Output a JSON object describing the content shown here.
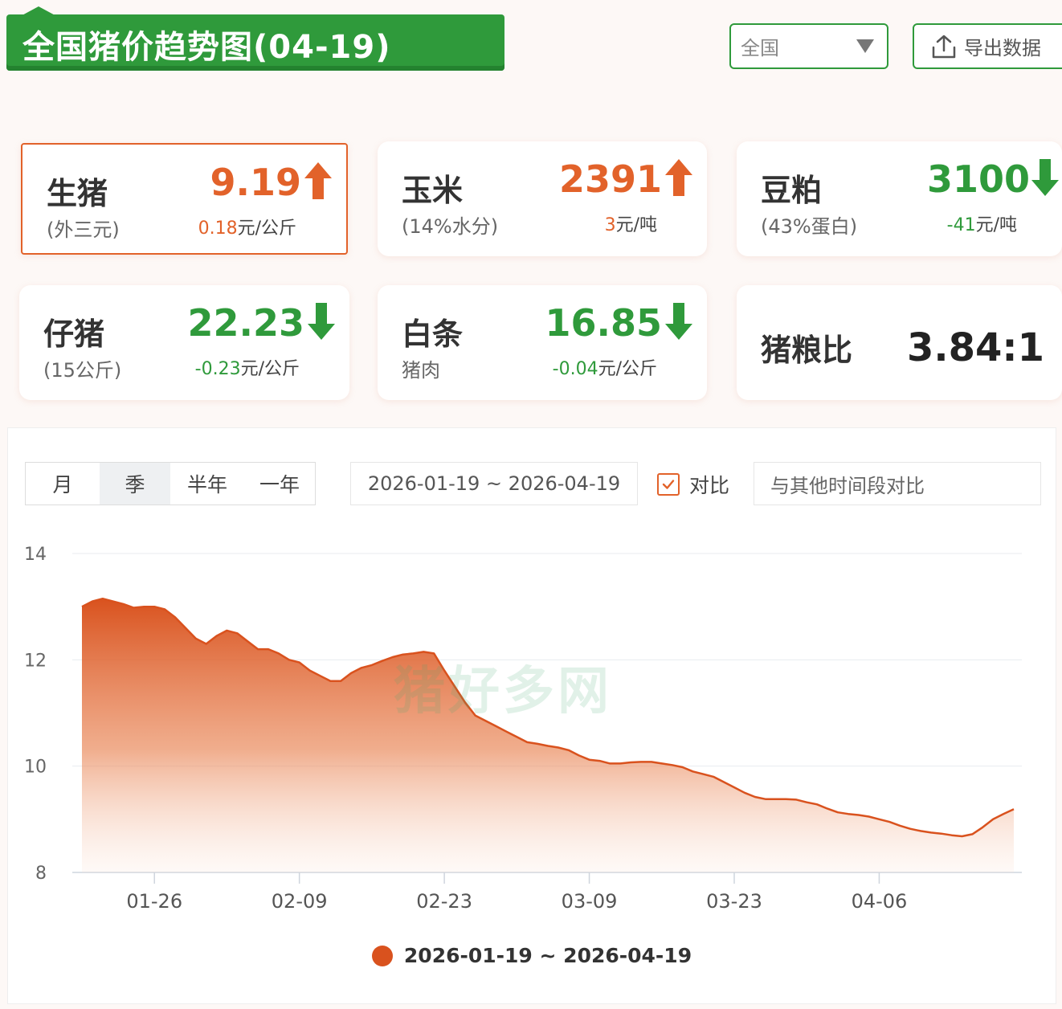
{
  "header": {
    "title": "全国猪价趋势图(04-19)",
    "region_value": "全国",
    "export_label": "导出数据"
  },
  "cards": [
    {
      "name": "生猪",
      "sub": "(外三元)",
      "value": "9.19",
      "trend": "up",
      "change_num": "0.18",
      "change_unit": "元/公斤"
    },
    {
      "name": "玉米",
      "sub": "(14%水分)",
      "value": "2391",
      "trend": "up",
      "change_num": "3",
      "change_unit": "元/吨"
    },
    {
      "name": "豆粕",
      "sub": "(43%蛋白)",
      "value": "3100",
      "trend": "down",
      "change_num": "-41",
      "change_unit": "元/吨"
    },
    {
      "name": "仔猪",
      "sub": "(15公斤)",
      "value": "22.23",
      "trend": "down",
      "change_num": "-0.23",
      "change_unit": "元/公斤"
    },
    {
      "name": "白条",
      "sub": "猪肉",
      "value": "16.85",
      "trend": "down",
      "change_num": "-0.04",
      "change_unit": "元/公斤"
    }
  ],
  "ratio": {
    "name": "猪粮比",
    "value": "3.84:1"
  },
  "controls": {
    "periods": [
      "月",
      "季",
      "半年",
      "一年"
    ],
    "selected_period": "季",
    "date_range": "2026-01-19 ~ 2026-04-19",
    "compare_label": "对比",
    "compare_checked": true,
    "compare_placeholder": "与其他时间段对比"
  },
  "watermark": "猪好多网",
  "colors": {
    "up": "#e2622a",
    "down": "#2f9a3b",
    "brand": "#2f9a3b",
    "series": "#d9521e"
  },
  "chart_data": {
    "type": "area",
    "ylim": [
      8,
      14
    ],
    "yticks": [
      8,
      10,
      12,
      14
    ],
    "grid": true,
    "xlim": [
      "2026-01-19",
      "2026-04-19"
    ],
    "xticks": [
      "01-26",
      "02-09",
      "02-23",
      "03-09",
      "03-23",
      "04-06"
    ],
    "xtick_dates": [
      "2026-01-26",
      "2026-02-09",
      "2026-02-23",
      "2026-03-09",
      "2026-03-23",
      "2026-04-06"
    ],
    "legend_position": "bottom-center",
    "series": [
      {
        "name": "2026-01-19 ~ 2026-04-19",
        "x": [
          "2026-01-19",
          "2026-01-20",
          "2026-01-21",
          "2026-01-22",
          "2026-01-23",
          "2026-01-24",
          "2026-01-25",
          "2026-01-26",
          "2026-01-27",
          "2026-01-28",
          "2026-01-29",
          "2026-01-30",
          "2026-01-31",
          "2026-02-01",
          "2026-02-02",
          "2026-02-03",
          "2026-02-04",
          "2026-02-05",
          "2026-02-06",
          "2026-02-07",
          "2026-02-08",
          "2026-02-09",
          "2026-02-10",
          "2026-02-11",
          "2026-02-12",
          "2026-02-13",
          "2026-02-14",
          "2026-02-15",
          "2026-02-16",
          "2026-02-17",
          "2026-02-18",
          "2026-02-19",
          "2026-02-20",
          "2026-02-21",
          "2026-02-22",
          "2026-02-23",
          "2026-02-24",
          "2026-02-25",
          "2026-02-26",
          "2026-02-27",
          "2026-02-28",
          "2026-03-01",
          "2026-03-02",
          "2026-03-03",
          "2026-03-04",
          "2026-03-05",
          "2026-03-06",
          "2026-03-07",
          "2026-03-08",
          "2026-03-09",
          "2026-03-10",
          "2026-03-11",
          "2026-03-12",
          "2026-03-13",
          "2026-03-14",
          "2026-03-15",
          "2026-03-16",
          "2026-03-17",
          "2026-03-18",
          "2026-03-19",
          "2026-03-20",
          "2026-03-21",
          "2026-03-22",
          "2026-03-23",
          "2026-03-24",
          "2026-03-25",
          "2026-03-26",
          "2026-03-27",
          "2026-03-28",
          "2026-03-29",
          "2026-03-30",
          "2026-03-31",
          "2026-04-01",
          "2026-04-02",
          "2026-04-03",
          "2026-04-04",
          "2026-04-05",
          "2026-04-06",
          "2026-04-07",
          "2026-04-08",
          "2026-04-09",
          "2026-04-10",
          "2026-04-11",
          "2026-04-12",
          "2026-04-13",
          "2026-04-14",
          "2026-04-15",
          "2026-04-16",
          "2026-04-17",
          "2026-04-18",
          "2026-04-19"
        ],
        "values": [
          13.0,
          13.1,
          13.15,
          13.1,
          13.05,
          12.98,
          13.0,
          13.0,
          12.95,
          12.8,
          12.6,
          12.4,
          12.3,
          12.45,
          12.55,
          12.5,
          12.35,
          12.2,
          12.2,
          12.12,
          12.0,
          11.95,
          11.8,
          11.7,
          11.6,
          11.6,
          11.75,
          11.85,
          11.9,
          11.98,
          12.05,
          12.1,
          12.12,
          12.15,
          12.12,
          11.8,
          11.5,
          11.2,
          10.95,
          10.85,
          10.75,
          10.65,
          10.55,
          10.45,
          10.42,
          10.38,
          10.35,
          10.3,
          10.2,
          10.12,
          10.1,
          10.05,
          10.05,
          10.07,
          10.08,
          10.08,
          10.05,
          10.02,
          9.98,
          9.9,
          9.85,
          9.8,
          9.7,
          9.6,
          9.5,
          9.42,
          9.38,
          9.38,
          9.38,
          9.37,
          9.32,
          9.28,
          9.2,
          9.13,
          9.1,
          9.08,
          9.05,
          9.0,
          8.95,
          8.88,
          8.82,
          8.78,
          8.75,
          8.73,
          8.7,
          8.68,
          8.72,
          8.85,
          9.0,
          9.1,
          9.19
        ]
      }
    ]
  }
}
